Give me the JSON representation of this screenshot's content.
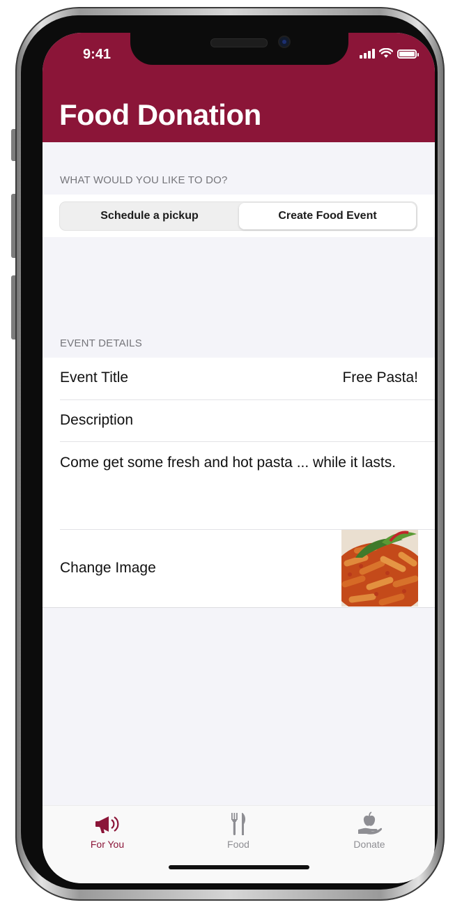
{
  "status_bar": {
    "time": "9:41"
  },
  "header": {
    "title": "Food Donation"
  },
  "mode_section": {
    "label": "WHAT WOULD YOU LIKE TO DO?",
    "options": [
      "Schedule a pickup",
      "Create Food Event"
    ],
    "selected": "Create Food Event"
  },
  "event_section": {
    "label": "EVENT DETAILS",
    "event_title_label": "Event Title",
    "event_title_value": "Free Pasta!",
    "description_label": "Description",
    "description_text": "Come get some fresh and hot pasta ... while it lasts.",
    "change_image_label": "Change Image"
  },
  "tab_bar": {
    "tabs": [
      {
        "label": "For You",
        "icon": "megaphone-icon",
        "active": true
      },
      {
        "label": "Food",
        "icon": "fork-knife-icon",
        "active": false
      },
      {
        "label": "Donate",
        "icon": "hand-apple-icon",
        "active": false
      }
    ]
  },
  "colors": {
    "brand": "#8b1538",
    "inactive_tab": "#8e8e93",
    "background": "#f4f4f9"
  }
}
